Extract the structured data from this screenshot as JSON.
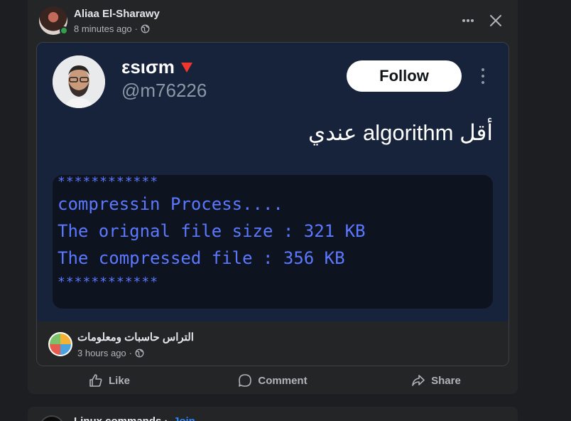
{
  "post": {
    "author": "Aliaa El-Sharawy",
    "time": "8 minutes ago",
    "separator": "·",
    "more_icon": "more-horizontal-icon",
    "close_icon": "close-icon"
  },
  "tweet": {
    "name": "εsισm",
    "badge_icon": "red-triangle-down-icon",
    "handle": "@m76226",
    "follow_label": "Follow",
    "text": "أقل algorithm عندي",
    "code": {
      "stars_top": "************",
      "line1": "compressin Process....",
      "line2": "The orignal file size : 321 KB",
      "line3": "The compressed file : 356 KB",
      "stars_bottom": "************"
    }
  },
  "shared_group": {
    "name": "التراس حاسبات ومعلومات",
    "time": "3 hours ago",
    "separator": "·"
  },
  "actions": {
    "like": "Like",
    "comment": "Comment",
    "share": "Share"
  },
  "next_post": {
    "title": "Linux commands",
    "separator": "·",
    "join": "Join"
  },
  "colors": {
    "background": "#1c1e21",
    "card": "#242526",
    "accent": "#2d88ff",
    "code_text": "#5b78ff",
    "online": "#31a24c"
  }
}
